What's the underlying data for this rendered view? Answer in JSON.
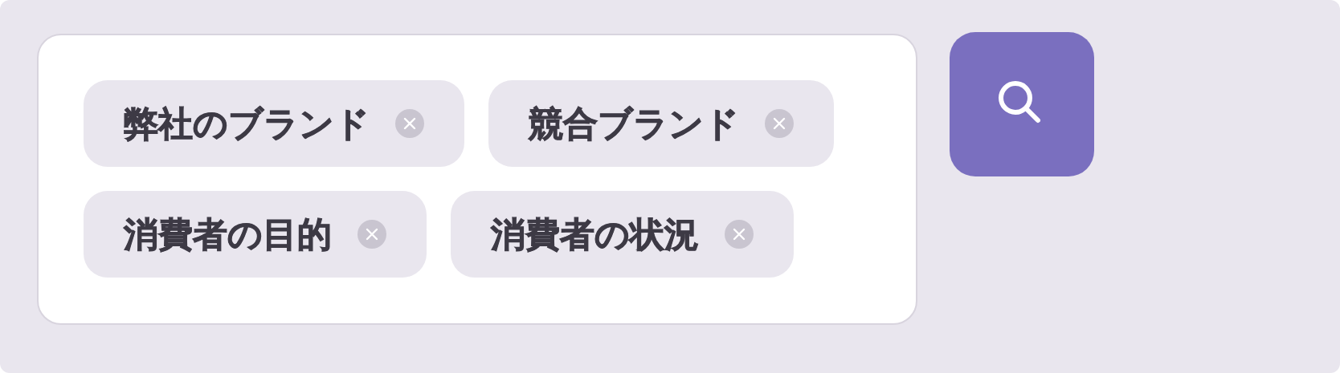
{
  "tags": [
    {
      "label": "弊社のブランド"
    },
    {
      "label": "競合ブランド"
    },
    {
      "label": "消費者の目的"
    },
    {
      "label": "消費者の状況"
    }
  ]
}
